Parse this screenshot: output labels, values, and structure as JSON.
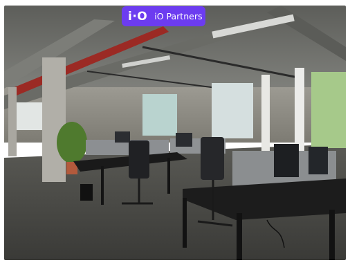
{
  "badge": {
    "logo_text": "i·O",
    "label": "iO Partners",
    "color": "#6c3cf0"
  },
  "photo": {
    "ceiling_color": "#6f706c",
    "floor_color": "#4a4a46",
    "desk_color": "#1a1a1a",
    "divider_color": "#8c8f92",
    "window_color": "#d9e4e3",
    "plant_color": "#4f7a2e",
    "duct_color": "#9b2a24"
  }
}
